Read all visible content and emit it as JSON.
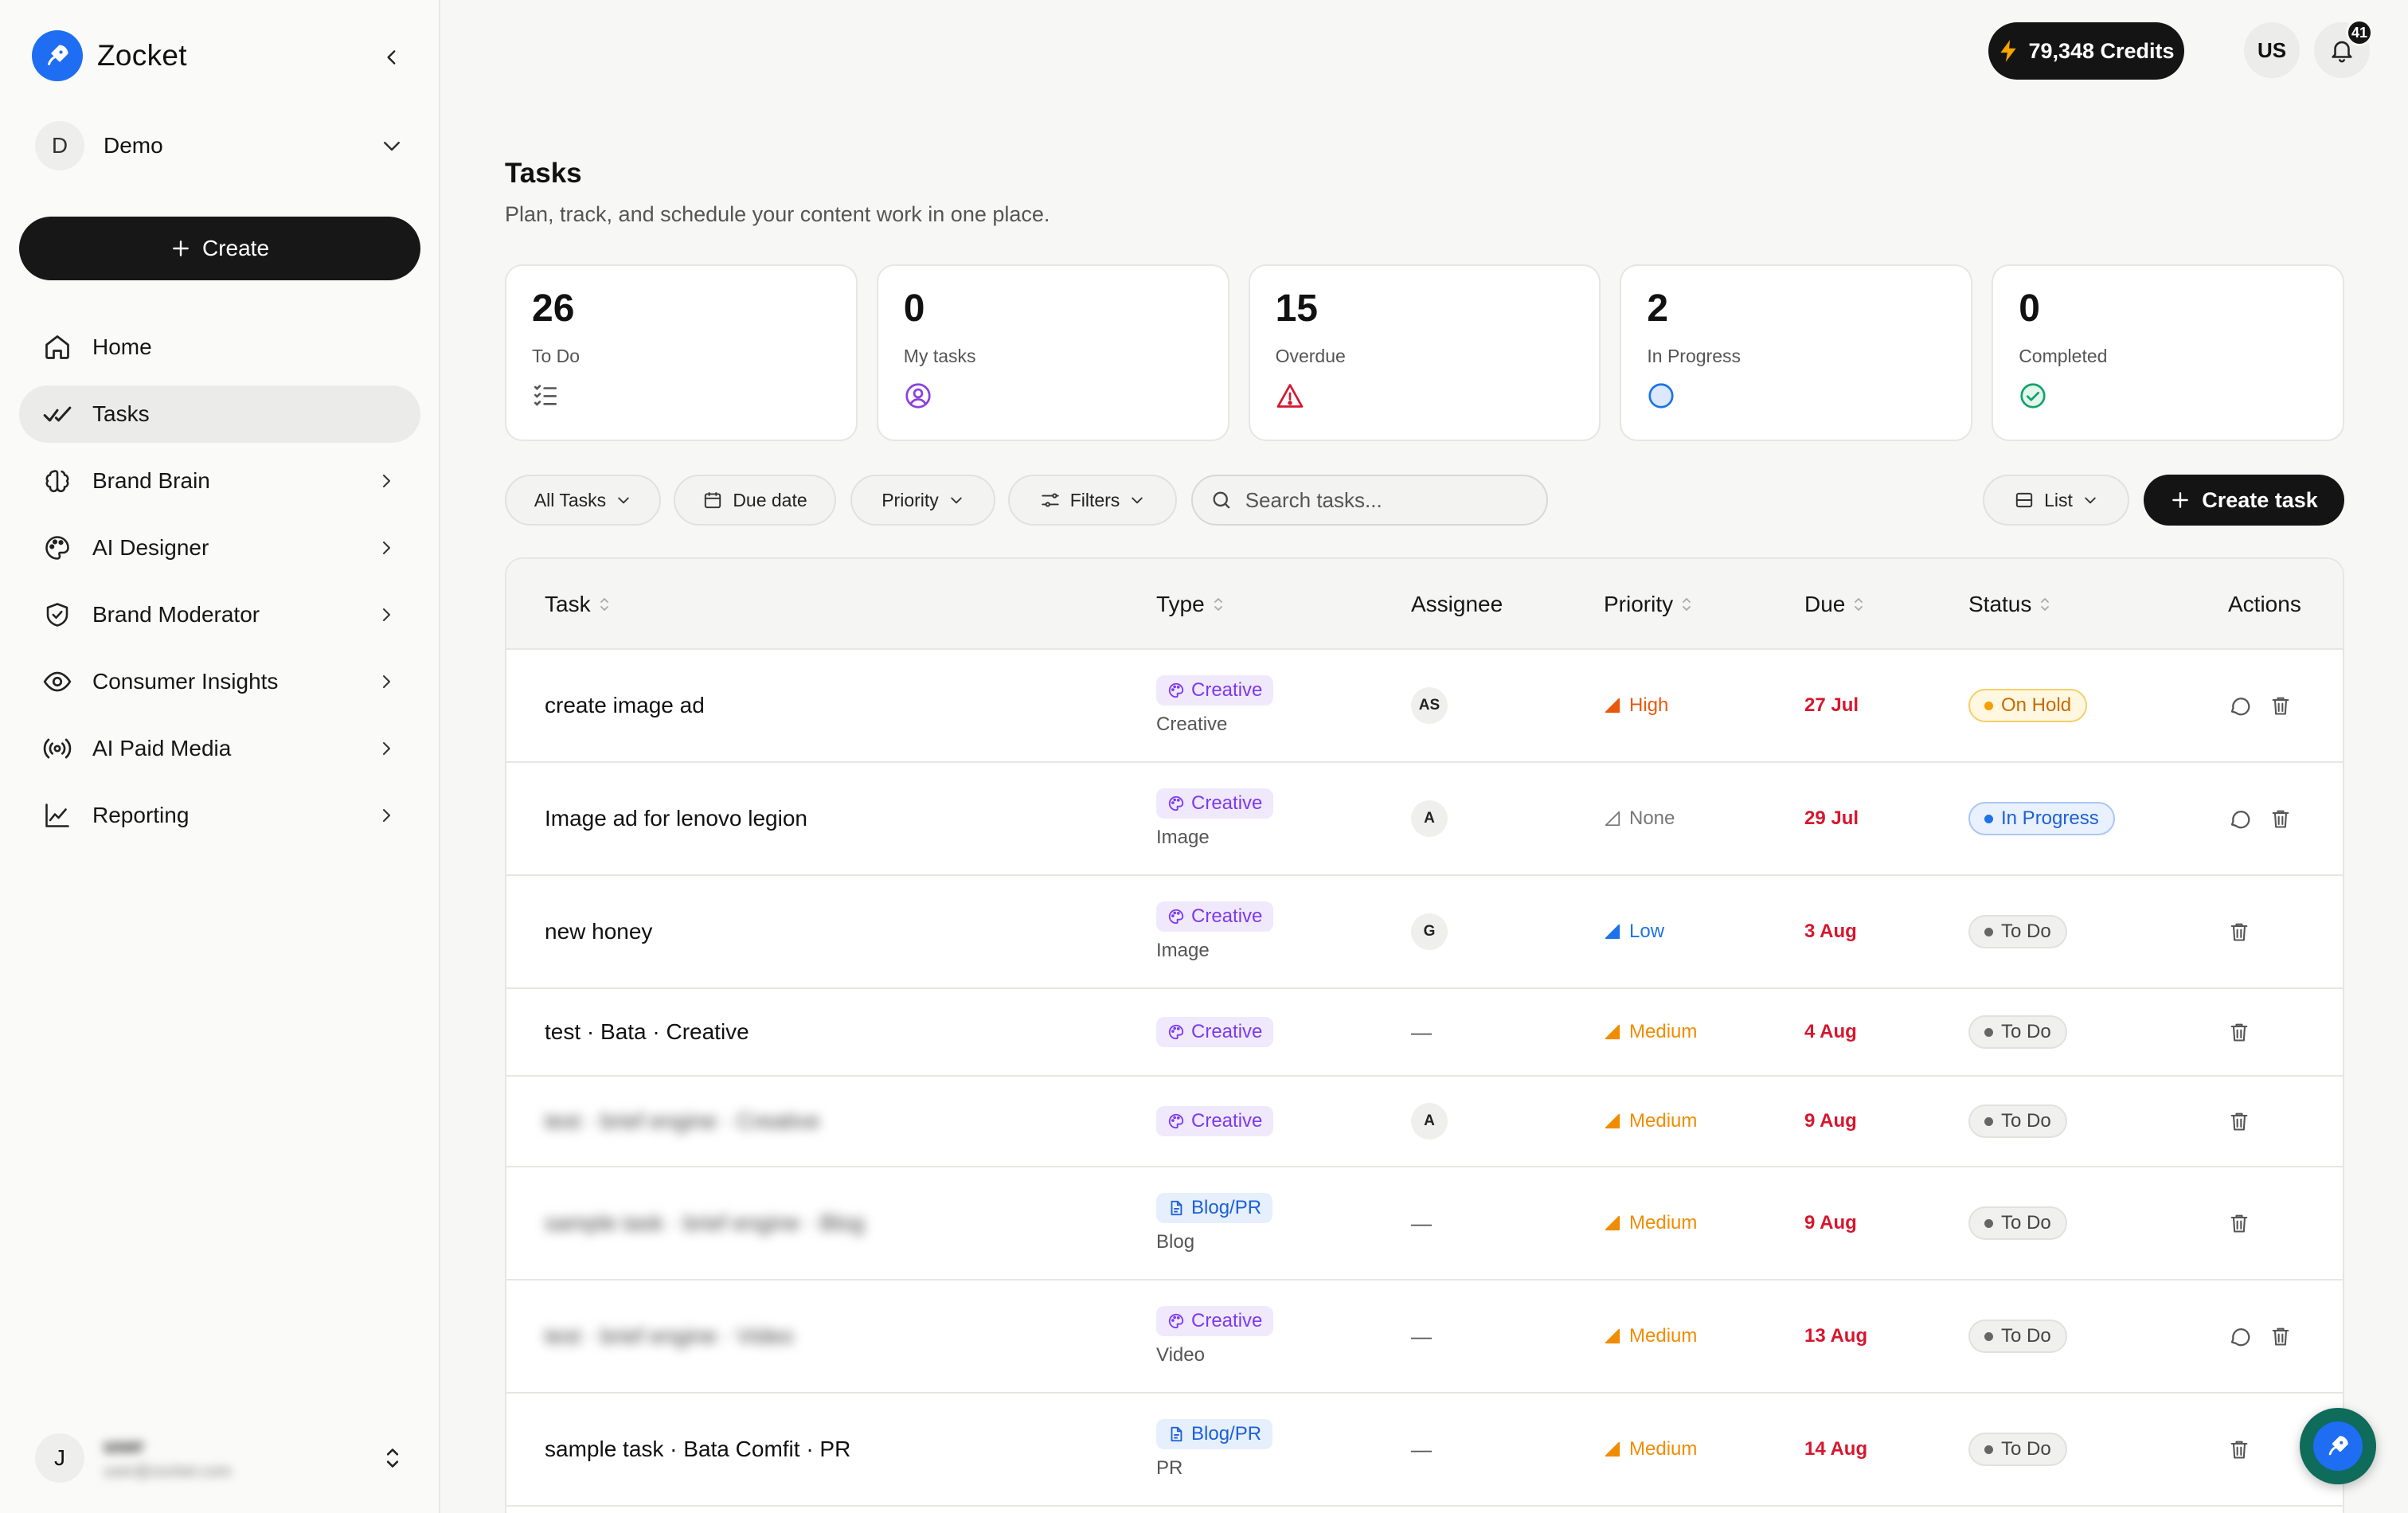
{
  "app": {
    "name": "Zocket"
  },
  "workspace": {
    "initial": "D",
    "name": "Demo"
  },
  "sidebar": {
    "create_label": "Create",
    "items": [
      {
        "label": "Home",
        "icon": "home-icon",
        "active": false,
        "chevron": false
      },
      {
        "label": "Tasks",
        "icon": "tasks-check-icon",
        "active": true,
        "chevron": false
      },
      {
        "label": "Brand Brain",
        "icon": "brain-icon",
        "active": false,
        "chevron": true
      },
      {
        "label": "AI Designer",
        "icon": "palette-icon",
        "active": false,
        "chevron": true
      },
      {
        "label": "Brand Moderator",
        "icon": "shield-check-icon",
        "active": false,
        "chevron": true
      },
      {
        "label": "Consumer Insights",
        "icon": "eye-icon",
        "active": false,
        "chevron": true
      },
      {
        "label": "AI Paid Media",
        "icon": "broadcast-icon",
        "active": false,
        "chevron": true
      },
      {
        "label": "Reporting",
        "icon": "line-chart-icon",
        "active": false,
        "chevron": true
      }
    ],
    "user": {
      "initial": "J",
      "name": "user",
      "email": "user@zocket.com"
    }
  },
  "topbar": {
    "credits": "79,348 Credits",
    "user_initials": "US",
    "notifications": "41"
  },
  "page": {
    "title": "Tasks",
    "subtitle": "Plan, track, and schedule your content work in one place."
  },
  "stats": [
    {
      "value": "26",
      "label": "To Do",
      "icon": "checklist-icon"
    },
    {
      "value": "0",
      "label": "My tasks",
      "icon": "user-circle-icon"
    },
    {
      "value": "15",
      "label": "Overdue",
      "icon": "warning-triangle-icon"
    },
    {
      "value": "2",
      "label": "In Progress",
      "icon": "progress-circle-icon"
    },
    {
      "value": "0",
      "label": "Completed",
      "icon": "check-circle-icon"
    }
  ],
  "toolbar": {
    "all_tasks": "All Tasks",
    "due_date": "Due date",
    "priority": "Priority",
    "filters": "Filters",
    "search_placeholder": "Search tasks...",
    "view": "List",
    "create_task": "Create task"
  },
  "table": {
    "columns": {
      "task": "Task",
      "type": "Type",
      "assignee": "Assignee",
      "priority": "Priority",
      "due": "Due",
      "status": "Status",
      "actions": "Actions"
    },
    "rows": [
      {
        "title": "create image ad",
        "blurred": false,
        "type": "Creative",
        "subtype": "Creative",
        "assignee": "AS",
        "priority": "High",
        "due": "27 Jul",
        "status": "On Hold",
        "comment": true
      },
      {
        "title": "Image ad for lenovo legion",
        "blurred": false,
        "type": "Creative",
        "subtype": "Image",
        "assignee": "A",
        "priority": "None",
        "due": "29 Jul",
        "status": "In Progress",
        "comment": true
      },
      {
        "title": "new honey",
        "blurred": false,
        "type": "Creative",
        "subtype": "Image",
        "assignee": "G",
        "priority": "Low",
        "due": "3 Aug",
        "status": "To Do",
        "comment": false
      },
      {
        "title": "test · Bata · Creative",
        "blurred": false,
        "type": "Creative",
        "subtype": "",
        "assignee": "—",
        "priority": "Medium",
        "due": "4 Aug",
        "status": "To Do",
        "comment": false
      },
      {
        "title": "test · brief engine · Creative",
        "blurred": true,
        "type": "Creative",
        "subtype": "",
        "assignee": "A",
        "priority": "Medium",
        "due": "9 Aug",
        "status": "To Do",
        "comment": false
      },
      {
        "title": "sample task · brief engine · Blog",
        "blurred": true,
        "type": "Blog/PR",
        "subtype": "Blog",
        "assignee": "—",
        "priority": "Medium",
        "due": "9 Aug",
        "status": "To Do",
        "comment": false
      },
      {
        "title": "test · brief engine · Video",
        "blurred": true,
        "type": "Creative",
        "subtype": "Video",
        "assignee": "—",
        "priority": "Medium",
        "due": "13 Aug",
        "status": "To Do",
        "comment": true
      },
      {
        "title": "sample task · Bata Comfit · PR",
        "blurred": false,
        "type": "Blog/PR",
        "subtype": "PR",
        "assignee": "—",
        "priority": "Medium",
        "due": "14 Aug",
        "status": "To Do",
        "comment": false
      }
    ]
  },
  "colors": {
    "accent": "#1e6df2",
    "overdue": "#d7162e",
    "high": "#e8590c",
    "medium": "#f08c00",
    "low": "#1d72e8",
    "creative": "#7c3aed",
    "blog": "#1d5fd6"
  }
}
